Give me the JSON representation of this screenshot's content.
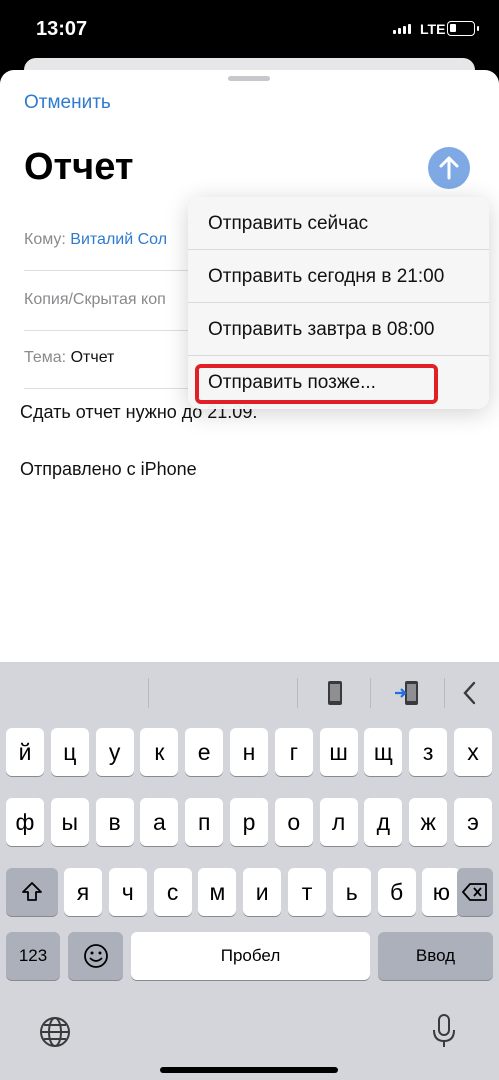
{
  "status": {
    "time": "13:07",
    "network": "LTE"
  },
  "compose": {
    "cancel": "Отменить",
    "title": "Отчет",
    "to_label": "Кому:",
    "to_value": "Виталий Сол",
    "cc_label": "Копия/Скрытая коп",
    "subject_label": "Тема:",
    "subject_value": "Отчет",
    "body_line1": "Сдать отчет нужно до 21.09.",
    "body_line2": "Отправлено с iPhone"
  },
  "send_menu": {
    "items": [
      "Отправить сейчас",
      "Отправить сегодня в 21:00",
      "Отправить завтра в 08:00",
      "Отправить позже..."
    ],
    "highlighted_index": 3
  },
  "keyboard": {
    "row1": [
      "й",
      "ц",
      "у",
      "к",
      "е",
      "н",
      "г",
      "ш",
      "щ",
      "з",
      "х"
    ],
    "row2": [
      "ф",
      "ы",
      "в",
      "а",
      "п",
      "р",
      "о",
      "л",
      "д",
      "ж",
      "э"
    ],
    "row3": [
      "я",
      "ч",
      "с",
      "м",
      "и",
      "т",
      "ь",
      "б",
      "ю"
    ],
    "numbers": "123",
    "space": "Пробел",
    "return": "Ввод"
  },
  "colors": {
    "accent": "#2f7bd0",
    "highlight": "#e01f26"
  }
}
